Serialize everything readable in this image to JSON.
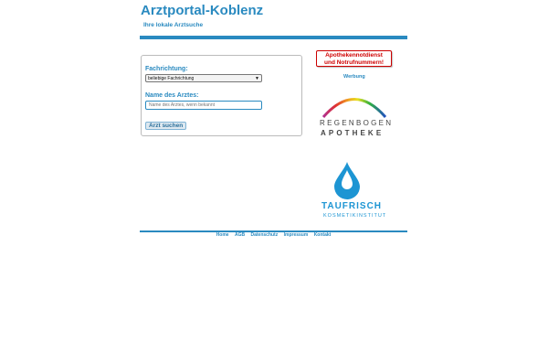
{
  "header": {
    "title": "Arztportal-Koblenz",
    "subtitle": "Ihre lokale Arztsuche"
  },
  "search_form": {
    "specialty_label": "Fachrichtung:",
    "specialty_selected": "beliebige Fachrichtung",
    "doctor_name_label": "Name des Arztes:",
    "doctor_name_placeholder": "Name des Arztes, wenn bekannt",
    "submit_label": "Arzt suchen"
  },
  "sidebar": {
    "emergency_button_line1": "Apothekennotdienst",
    "emergency_button_line2": "und Notrufnummern!",
    "ad_label": "Werbung",
    "ad1": {
      "line1": "REGENBOGEN",
      "line2": "APOTHEKE"
    },
    "ad2": {
      "line1": "TAUFRISCH",
      "line2": "KOSMETIKINSTITUT"
    }
  },
  "footer": {
    "links": [
      "Home",
      "AGB",
      "Datenschutz",
      "Impressum",
      "Kontakt"
    ]
  },
  "colors": {
    "accent": "#2a8ac0",
    "emergency": "#d00000",
    "taufrisch": "#1d95d3"
  }
}
